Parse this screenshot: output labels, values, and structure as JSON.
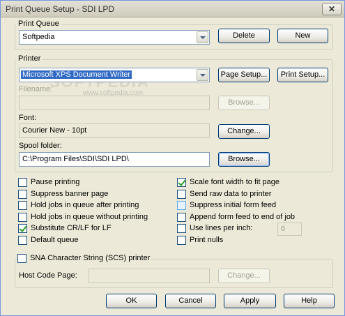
{
  "window": {
    "title": "Print Queue Setup - SDI LPD",
    "close_glyph": "✕"
  },
  "print_queue": {
    "legend": "Print Queue",
    "selected": "Softpedia",
    "delete_label": "Delete",
    "new_label": "New"
  },
  "printer": {
    "legend": "Printer",
    "selected": "Microsoft XPS Document Writer",
    "page_setup_label": "Page Setup...",
    "print_setup_label": "Print Setup...",
    "filename_label": "Filename:",
    "filename_value": "",
    "filename_browse_label": "Browse...",
    "font_label": "Font:",
    "font_value": "Courier New - 10pt",
    "change_font_label": "Change...",
    "spool_label": "Spool folder:",
    "spool_value": "C:\\Program Files\\SDI\\SDI LPD\\",
    "spool_browse_label": "Browse...",
    "watermark": "SOFTPEDIA",
    "watermark_url": "www.softpedia.com"
  },
  "options_left": [
    {
      "label": "Pause printing",
      "checked": false
    },
    {
      "label": "Suppress banner page",
      "checked": false
    },
    {
      "label": "Hold jobs in queue after printing",
      "checked": false
    },
    {
      "label": "Hold jobs in queue without printing",
      "checked": false
    },
    {
      "label": "Substitute CR/LF for LF",
      "checked": true
    },
    {
      "label": "Default queue",
      "checked": false
    }
  ],
  "options_right": [
    {
      "label": "Scale font width to fit page",
      "checked": true
    },
    {
      "label": "Send raw data to printer",
      "checked": false
    },
    {
      "label": "Suppress initial form feed",
      "checked": false,
      "highlighted": true
    },
    {
      "label": "Append form feed to end of job",
      "checked": false
    },
    {
      "label": "Use lines per inch:",
      "checked": false
    },
    {
      "label": "Print nulls",
      "checked": false
    }
  ],
  "lines_per_inch": {
    "value": "6"
  },
  "sna": {
    "label": "SNA Character String (SCS) printer",
    "checked": false,
    "host_code_page_label": "Host Code Page:",
    "host_code_page_value": "",
    "change_label": "Change..."
  },
  "footer": {
    "ok_label": "OK",
    "cancel_label": "Cancel",
    "apply_label": "Apply",
    "help_label": "Help"
  },
  "colors": {
    "accent": "#316ac5",
    "check": "#21a121",
    "disabled_text": "#a1a192"
  }
}
